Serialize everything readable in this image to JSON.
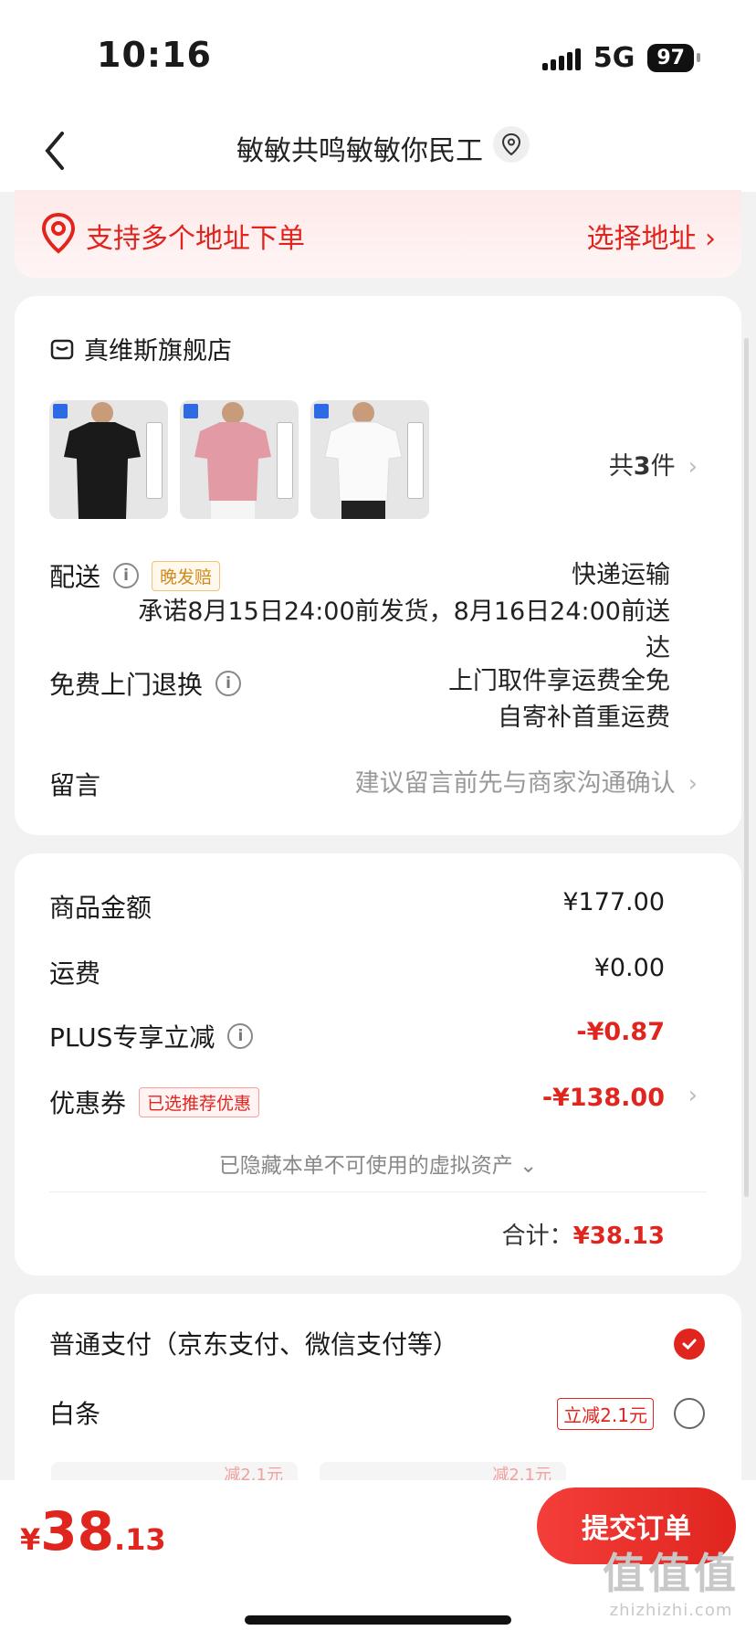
{
  "status_bar": {
    "time": "10:16",
    "network": "5G",
    "battery": "97"
  },
  "nav": {
    "title": "敏敏共鸣敏敏你民工"
  },
  "address_banner": {
    "text": "支持多个地址下单",
    "select_label": "选择地址 ›"
  },
  "shop": {
    "name": "真维斯旗舰店",
    "products": [
      {
        "color": "#1a1a1a",
        "icon": "black-tshirt-image"
      },
      {
        "color": "#e29aa4",
        "icon": "pink-tshirt-image"
      },
      {
        "color": "#fafafa",
        "icon": "white-tshirt-image"
      }
    ],
    "count_prefix": "共",
    "count_num": "3",
    "count_suffix": "件"
  },
  "delivery": {
    "label": "配送",
    "tag": "晚发赔",
    "method": "快递运输",
    "promise": "承诺8月15日24:00前发货，8月16日24:00前送达"
  },
  "return_service": {
    "label": "免费上门退换",
    "line1": "上门取件享运费全免",
    "line2": "自寄补首重运费"
  },
  "message": {
    "label": "留言",
    "placeholder": "建议留言前先与商家沟通确认"
  },
  "price": {
    "goods_label": "商品金额",
    "goods_value": "¥177.00",
    "shipping_label": "运费",
    "shipping_value": "¥0.00",
    "plus_label": "PLUS专享立减",
    "plus_value": "-¥0.87",
    "coupon_label": "优惠券",
    "coupon_tag": "已选推荐优惠",
    "coupon_value": "-¥138.00",
    "hidden_assets": "已隐藏本单不可使用的虚拟资产 ⌄",
    "total_label": "合计：",
    "total_value": "¥38.13"
  },
  "payment": {
    "normal_label": "普通支付（京东支付、微信支付等）",
    "baitiao_label": "白条",
    "baitiao_tag": "立减2.1元",
    "peek1": "减2.1元",
    "peek2": "减2.1元"
  },
  "bottom": {
    "currency": "¥",
    "int_part": "38",
    "dec_part": ".13",
    "submit_label": "提交订单",
    "watermark_top": "值值值",
    "watermark_bottom": "zhizhizhi.com"
  },
  "colors": {
    "accent": "#e0251e",
    "background": "#f2f2f2"
  }
}
